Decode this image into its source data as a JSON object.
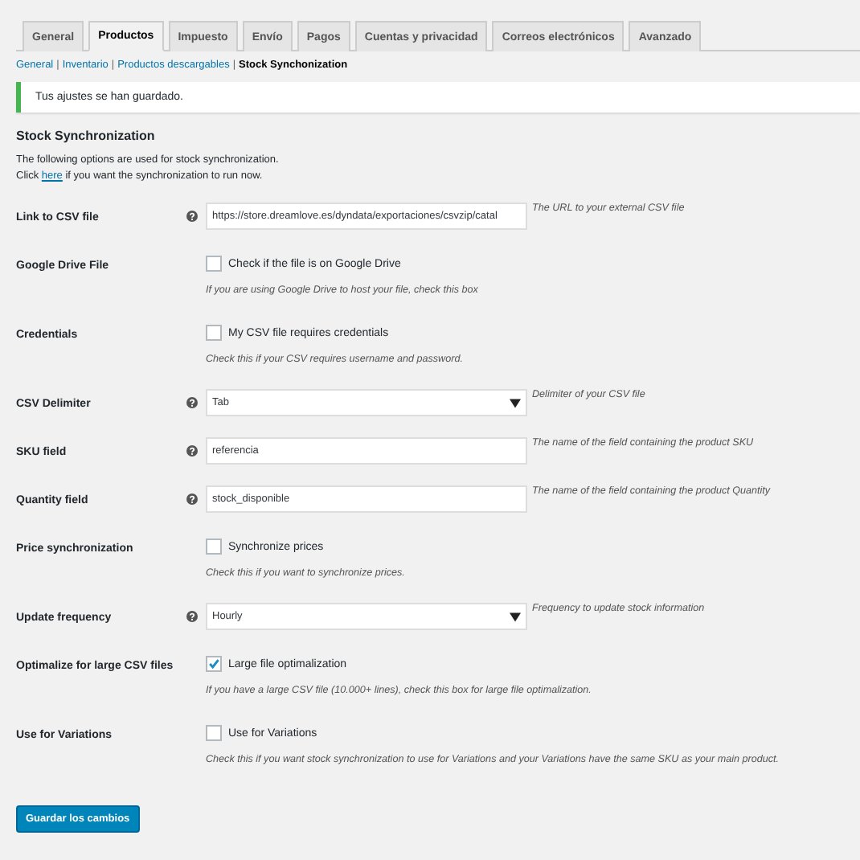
{
  "tabs": [
    {
      "label": "General",
      "selected": false
    },
    {
      "label": "Productos",
      "selected": true
    },
    {
      "label": "Impuesto",
      "selected": false
    },
    {
      "label": "Envío",
      "selected": false
    },
    {
      "label": "Pagos",
      "selected": false
    },
    {
      "label": "Cuentas y privacidad",
      "selected": false
    },
    {
      "label": "Correos electrónicos",
      "selected": false
    },
    {
      "label": "Avanzado",
      "selected": false
    }
  ],
  "subnav": [
    {
      "label": "General",
      "selected": false
    },
    {
      "label": "Inventario",
      "selected": false
    },
    {
      "label": "Productos descargables",
      "selected": false
    },
    {
      "label": "Stock Synchonization",
      "selected": true
    }
  ],
  "subnav_separator": "|",
  "notice": "Tus ajustes se han guardado.",
  "heading": "Stock Synchronization",
  "intro": "The following options are used for stock synchronization.",
  "intro2": {
    "before": "Click",
    "link": "here",
    "after": "if you want the synchronization to run now."
  },
  "settings": [
    {
      "kind": "text",
      "label": "Link to CSV file",
      "value": "https://store.dreamlove.es/dyndata/exportaciones/csvzip/catal",
      "description": "The URL to your external CSV file"
    },
    {
      "kind": "checkbox",
      "label": "Google Drive File",
      "option": "Check if the file is on Google Drive",
      "checked": false,
      "description": "If you are using Google Drive to host your file, check this box"
    },
    {
      "kind": "checkbox",
      "label": "Credentials",
      "option": "My CSV file requires credentials",
      "checked": false,
      "description": "Check this if your CSV requires username and password."
    },
    {
      "kind": "select",
      "label": "CSV Delimiter",
      "value": "Tab",
      "description": "Delimiter of your CSV file"
    },
    {
      "kind": "text",
      "label": "SKU field",
      "value": "referencia",
      "description": "The name of the field containing the product SKU"
    },
    {
      "kind": "text",
      "label": "Quantity field",
      "value": "stock_disponible",
      "description": "The name of the field containing the product Quantity"
    },
    {
      "kind": "checkbox",
      "label": "Price synchronization",
      "option": "Synchronize prices",
      "checked": false,
      "description": "Check this if you want to synchronize prices."
    },
    {
      "kind": "select",
      "label": "Update frequency",
      "value": "Hourly",
      "description": "Frequency to update stock information"
    },
    {
      "kind": "checkbox",
      "label": "Optimalize for large CSV files",
      "option": "Large file optimalization",
      "checked": true,
      "description": "If you have a large CSV file (10.000+ lines), check this box for large file optimalization."
    },
    {
      "kind": "checkbox",
      "label": "Use for Variations",
      "option": "Use for Variations",
      "checked": false,
      "description": "Check this if you want stock synchronization to use for Variations and your Variations have the same SKU as your main product."
    }
  ],
  "save_button": "Guardar los cambios"
}
